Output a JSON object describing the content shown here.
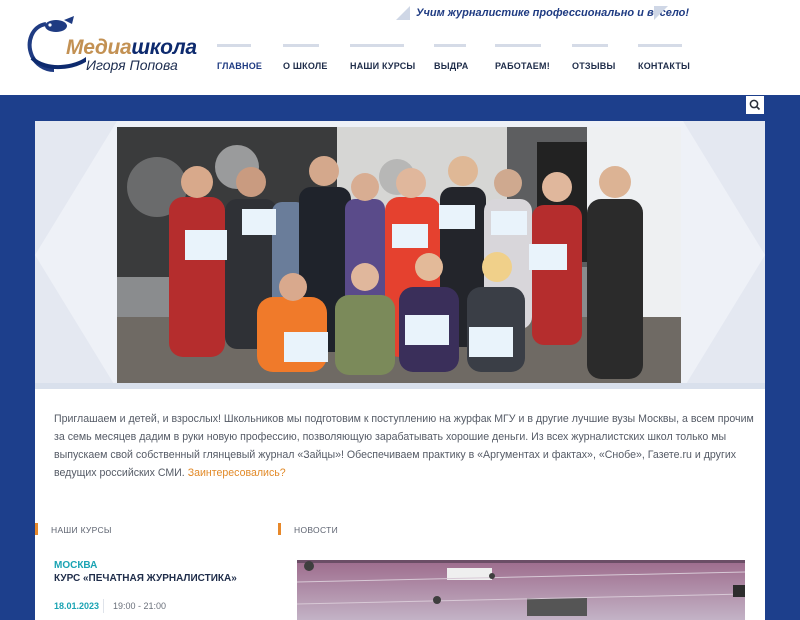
{
  "header": {
    "logo": {
      "word1": "Медиа",
      "word2": "школа",
      "subtitle": "Игоря Попова"
    },
    "slogan": "Учим журналистике профессионально и весело!",
    "nav": [
      {
        "label": "ГЛАВНОЕ",
        "active": true
      },
      {
        "label": "О ШКОЛЕ",
        "active": false
      },
      {
        "label": "НАШИ КУРСЫ",
        "active": false
      },
      {
        "label": "ВЫДРА",
        "active": false
      },
      {
        "label": "РАБОТАЕМ!",
        "active": false
      },
      {
        "label": "ОТЗЫВЫ",
        "active": false
      },
      {
        "label": "КОНТАКТЫ",
        "active": false
      }
    ]
  },
  "search": {
    "icon": "search-icon"
  },
  "intro": {
    "text": "Приглашаем и детей, и взрослых! Школьников мы подготовим к поступлению на журфак МГУ и в другие лучшие вузы Москвы, а всем прочим за семь месяцев дадим в руки новую профессию, позволяющую зарабатывать хорошие деньги. Из всех журналистских школ только мы выпускаем свой собственный глянцевый журнал «Зайцы»! Обеспечиваем практику в «Аргументах и фактах», «Снобе», Газете.ru и других ведущих российских СМИ. ",
    "link": "Заинтересовались?"
  },
  "courses": {
    "heading": "НАШИ КУРСЫ",
    "city": "МОСКВА",
    "title": "КУРС «ПЕЧАТНАЯ ЖУРНАЛИСТИКА»",
    "date": "18.01.2023",
    "time": "19:00 - 21:00"
  },
  "news": {
    "heading": "НОВОСТИ"
  },
  "colors": {
    "brand_blue": "#1d3f8c",
    "accent_orange": "#e7882a",
    "teal": "#1aa3b3",
    "logo_gold": "#c39153"
  }
}
